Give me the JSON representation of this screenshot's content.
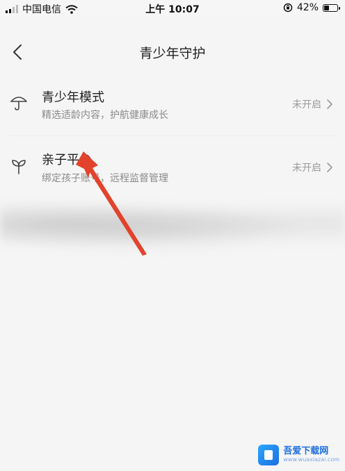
{
  "status_bar": {
    "carrier": "中国电信",
    "time": "上午 10:07",
    "battery": "42%",
    "battery_level": 0.42
  },
  "nav": {
    "title": "青少年守护"
  },
  "items": [
    {
      "title": "青少年模式",
      "subtitle": "精选适龄内容，护航健康成长",
      "status": "未开启",
      "icon": "umbrella-icon"
    },
    {
      "title": "亲子平台",
      "subtitle": "绑定孩子账号，远程监督管理",
      "status": "未开启",
      "icon": "sprout-icon"
    }
  ],
  "watermark": {
    "name": "吾爱下载网",
    "url": "www.wuaxiazai.com"
  },
  "colors": {
    "arrow": "#e2432c",
    "watermark": "#1d6fe0"
  }
}
